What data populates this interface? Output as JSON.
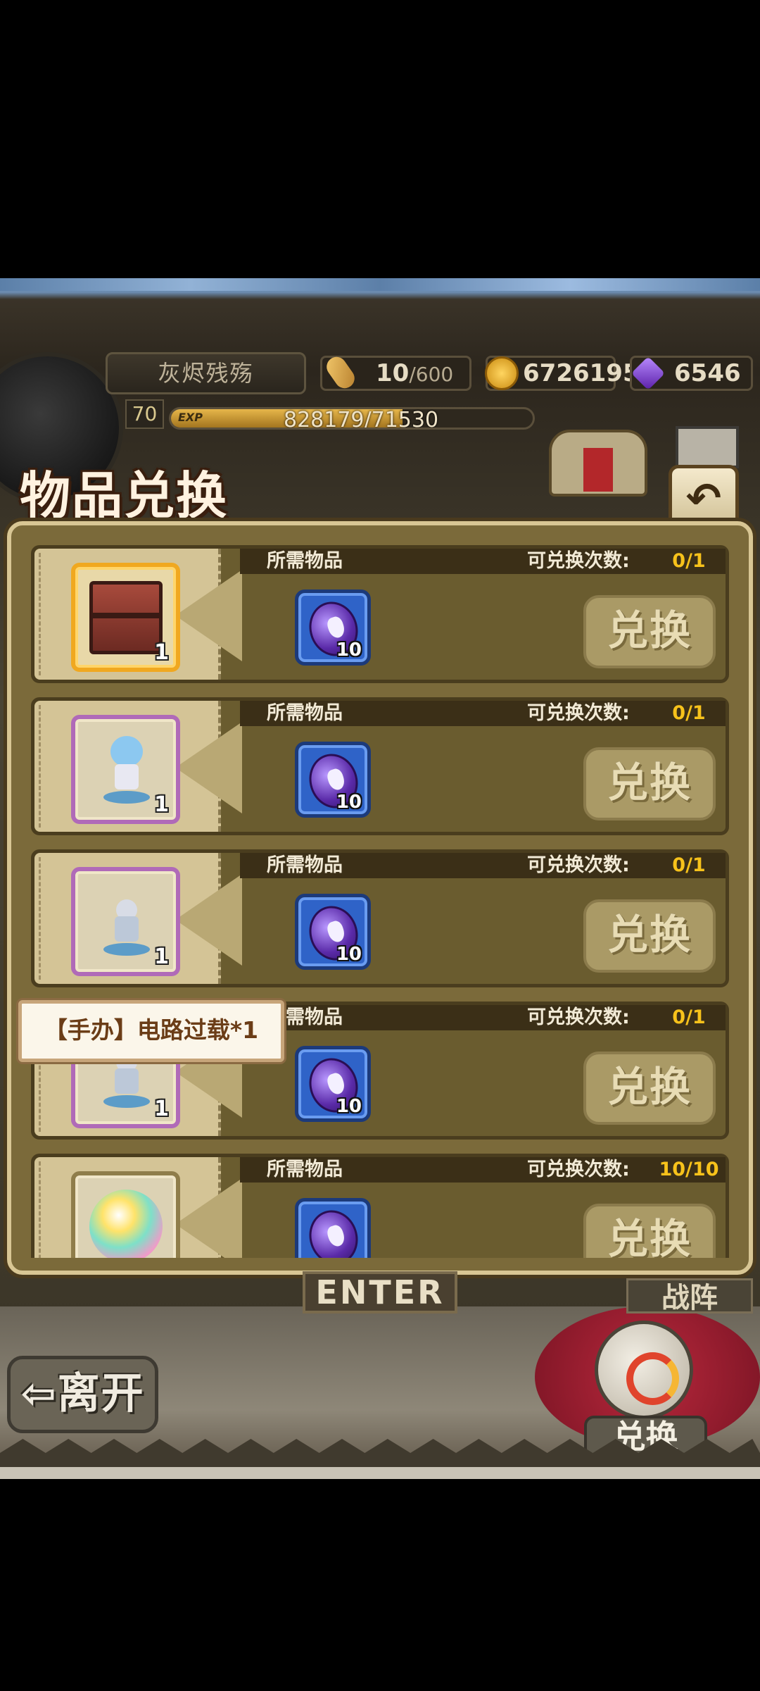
{
  "hud": {
    "player_name": "灰烬残殇",
    "stamina": "10",
    "stamina_max": "/600",
    "gold": "6726195",
    "gems": "6546",
    "level": "70",
    "exp_label": "EXP",
    "exp_text": "828179/71530",
    "exp_progress": 0.64
  },
  "header": {
    "title": "物品兑换",
    "back_icon": "back-arrow-icon"
  },
  "exchange": {
    "need_label": "所需物品",
    "limit_label": "可兑换次数:",
    "button_label": "兑换",
    "rows": [
      {
        "reward_icon": "crate-icon",
        "reward_qty": "1",
        "cost_icon": "purple-coin-icon",
        "cost_qty": "10",
        "limit": "0/1"
      },
      {
        "reward_icon": "figure-icon",
        "reward_qty": "1",
        "cost_icon": "purple-coin-icon",
        "cost_qty": "10",
        "limit": "0/1"
      },
      {
        "reward_icon": "figure-icon",
        "reward_qty": "1",
        "cost_icon": "purple-coin-icon",
        "cost_qty": "10",
        "limit": "0/1"
      },
      {
        "reward_icon": "figure-icon",
        "reward_qty": "1",
        "cost_icon": "purple-coin-icon",
        "cost_qty": "10",
        "limit": "0/1"
      },
      {
        "reward_icon": "orb-icon",
        "reward_qty": "",
        "cost_icon": "purple-coin-icon",
        "cost_qty": "",
        "limit": "10/10"
      }
    ]
  },
  "tooltip": {
    "text": "【手办】电路过载*1"
  },
  "bottom": {
    "enter_sign": "ENTER",
    "battle_sign": "战阵",
    "leave_label": "离开",
    "exchange_nav_label": "兑换"
  }
}
